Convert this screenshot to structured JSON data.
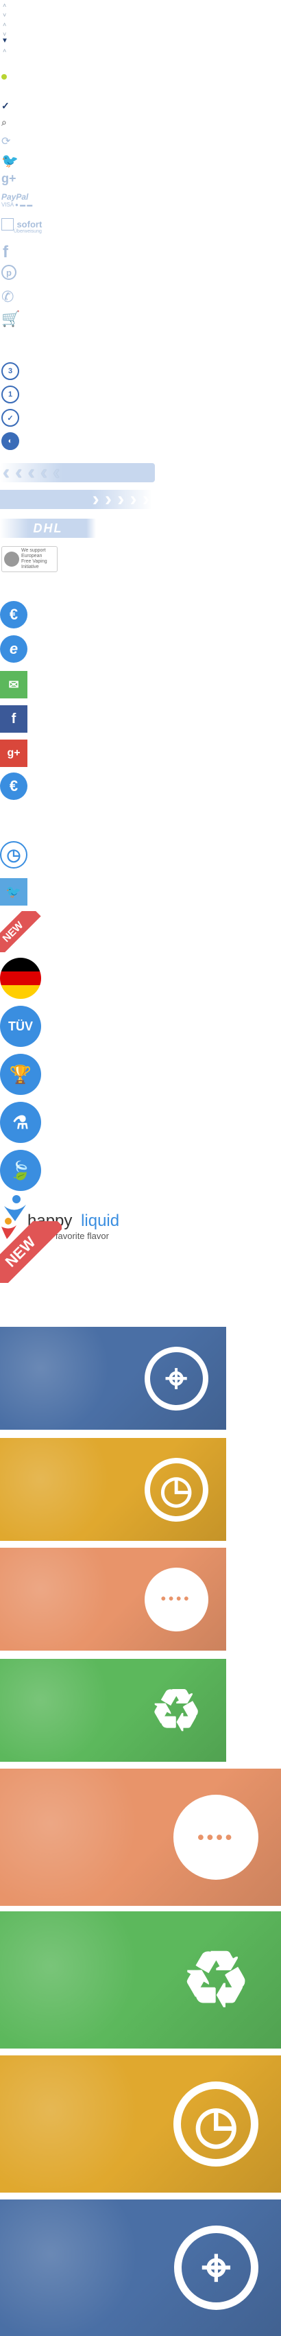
{
  "top_arrows": [
    "˄",
    "˅",
    "˄",
    "˅",
    "▼",
    "˄"
  ],
  "sprites": {
    "dot_color": "#b8d432",
    "check": "✓",
    "search": "⌕",
    "google_plus_text": "g+",
    "paypal_label": "PayPal",
    "paypal_sub": "VISA ● ▬ ▬",
    "sofort_label": "sofort",
    "sofort_sub": "Überweisung",
    "facebook_text": "f",
    "pinterest_text": "p",
    "phone_glyph": "✆",
    "cart_glyph": "🛒"
  },
  "circles": [
    "3",
    "1",
    "✓",
    "◐"
  ],
  "chevron_bars": {
    "left": "‹ ‹ ‹ ‹ ‹",
    "right": "› › › › ›"
  },
  "dhl": "DHL",
  "support_badge": {
    "line1": "We support",
    "line2": "European",
    "line3": "Free Vaping",
    "line4": "Initiative"
  },
  "social_buttons": [
    {
      "icon": "e-icon",
      "text": "€"
    },
    {
      "icon": "e-icon",
      "text": "e"
    },
    {
      "icon": "mail-icon",
      "text": "✉"
    },
    {
      "icon": "facebook-icon",
      "text": "f"
    },
    {
      "icon": "google-plus-icon",
      "text": "g+"
    },
    {
      "icon": "euro-icon",
      "text": "€"
    }
  ],
  "clock_glyph": "◷",
  "twitter_glyph": "🐦",
  "ribbon_new": "NEW",
  "tuv_label": "TÜV",
  "badges": [
    "🏆",
    "⚗",
    "🍃"
  ],
  "logo": {
    "brand_part1": "happy",
    "brand_part2": "liquid",
    "tagline": "your favorite flavor"
  },
  "ribbon_new_2": "NEW",
  "banners": [
    {
      "name": "banner-target-blue-small",
      "color": "#4a6fa5",
      "icon": "target-icon",
      "glyph": "⌖"
    },
    {
      "name": "banner-support-yellow-small",
      "color": "#e0a82e",
      "icon": "headset-clock-icon",
      "glyph": "◷"
    },
    {
      "name": "banner-chat-orange-small",
      "color": "#e8946a",
      "icon": "chat-bubble-icon",
      "glyph": "••••"
    },
    {
      "name": "banner-recycle-green-small",
      "color": "#5cb85c",
      "icon": "recycle-icon",
      "glyph": "♻"
    },
    {
      "name": "banner-chat-orange-large",
      "color": "#e8946a",
      "icon": "chat-bubble-icon",
      "glyph": "••••"
    },
    {
      "name": "banner-recycle-green-large",
      "color": "#5cb85c",
      "icon": "recycle-icon",
      "glyph": "♻"
    },
    {
      "name": "banner-support-yellow-large",
      "color": "#e0a82e",
      "icon": "headset-clock-icon",
      "glyph": "◷"
    },
    {
      "name": "banner-target-blue-large",
      "color": "#4a6fa5",
      "icon": "target-icon",
      "glyph": "⌖"
    }
  ],
  "colors": {
    "blue": "#3a8ee0",
    "twitter": "#5aa6e0",
    "facebook": "#3b5998",
    "google": "#d9473b",
    "mail": "#5cb85c",
    "icon_light": "#a9bfdc"
  }
}
